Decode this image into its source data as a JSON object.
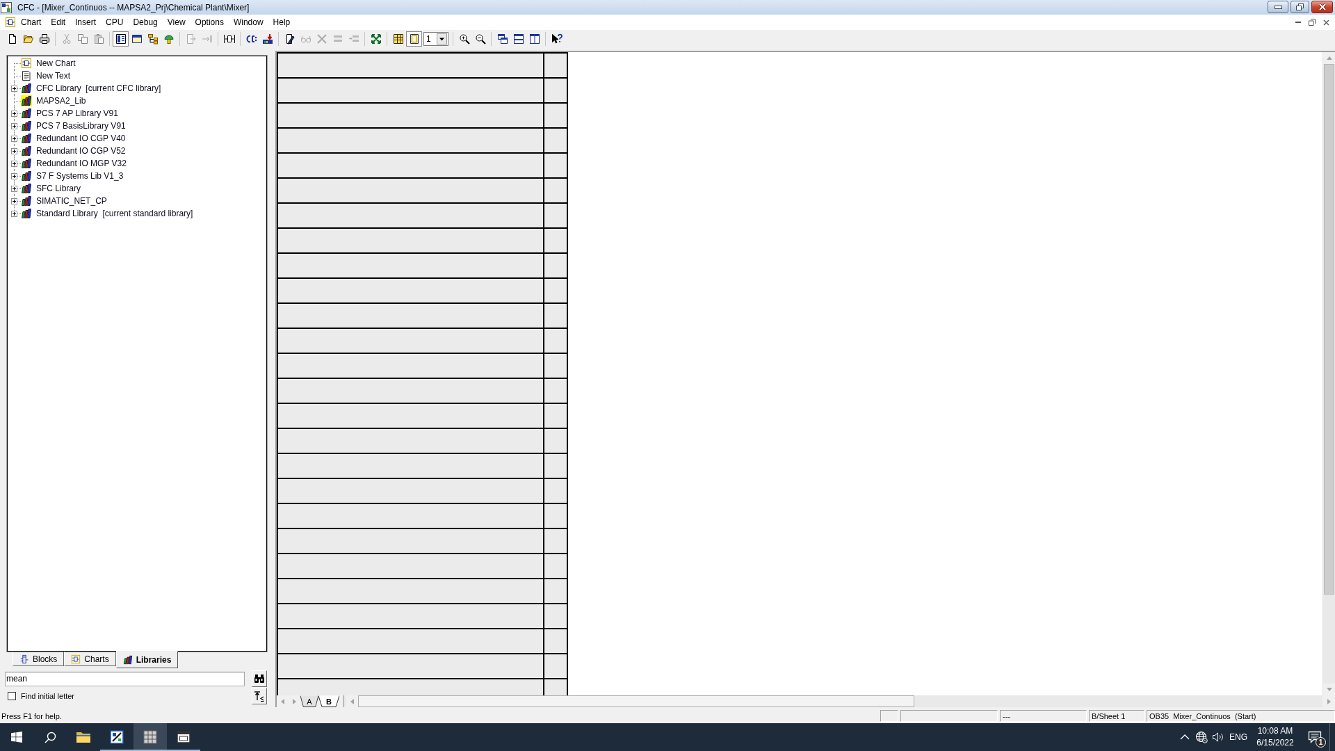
{
  "window": {
    "title": "CFC - [Mixer_Continuos -- MAPSA2_Prj\\Chemical Plant\\Mixer]"
  },
  "menu": [
    "Chart",
    "Edit",
    "Insert",
    "CPU",
    "Debug",
    "View",
    "Options",
    "Window",
    "Help"
  ],
  "toolbar": {
    "groups": [
      [
        {
          "kind": "new",
          "disabled": false,
          "pressed": false
        },
        {
          "kind": "open",
          "disabled": false,
          "pressed": false
        },
        {
          "kind": "print",
          "disabled": false,
          "pressed": false
        }
      ],
      [
        {
          "kind": "cut",
          "disabled": true,
          "pressed": false
        },
        {
          "kind": "copy",
          "disabled": true,
          "pressed": false
        },
        {
          "kind": "paste",
          "disabled": true,
          "pressed": false
        }
      ],
      [
        {
          "kind": "catalog",
          "disabled": false,
          "pressed": true
        },
        {
          "kind": "window",
          "disabled": false,
          "pressed": false
        },
        {
          "kind": "tree",
          "disabled": false,
          "pressed": false
        },
        {
          "kind": "lamp",
          "disabled": false,
          "pressed": false
        }
      ],
      [
        {
          "kind": "pagearrow",
          "disabled": true,
          "pressed": false
        },
        {
          "kind": "arrowbar",
          "disabled": true,
          "pressed": false
        }
      ],
      [
        {
          "kind": "block",
          "disabled": false,
          "pressed": false
        }
      ],
      [
        {
          "kind": "brackets",
          "disabled": false,
          "pressed": false
        },
        {
          "kind": "download",
          "disabled": false,
          "pressed": false
        }
      ],
      [
        {
          "kind": "pencil",
          "disabled": false,
          "pressed": false
        },
        {
          "kind": "glasses",
          "disabled": true,
          "pressed": false
        },
        {
          "kind": "tools",
          "disabled": true,
          "pressed": false
        },
        {
          "kind": "bars",
          "disabled": true,
          "pressed": false
        },
        {
          "kind": "barsarrow",
          "disabled": true,
          "pressed": false
        }
      ],
      [
        {
          "kind": "fit",
          "disabled": false,
          "pressed": false
        }
      ],
      [
        {
          "kind": "table",
          "disabled": false,
          "pressed": false
        },
        {
          "kind": "sheet",
          "disabled": false,
          "pressed": true
        },
        {
          "kind": "combo",
          "value": "1"
        }
      ],
      [
        {
          "kind": "zoomin",
          "disabled": false,
          "pressed": false
        },
        {
          "kind": "zoomout",
          "disabled": false,
          "pressed": false
        }
      ],
      [
        {
          "kind": "cascade",
          "disabled": false,
          "pressed": false
        },
        {
          "kind": "hsplit",
          "disabled": false,
          "pressed": false
        },
        {
          "kind": "vsplit",
          "disabled": false,
          "pressed": false
        }
      ],
      [
        {
          "kind": "help",
          "disabled": false,
          "pressed": false
        }
      ]
    ]
  },
  "catalog": {
    "tree": [
      {
        "label": "New Chart",
        "kind": "chart",
        "highlighted": false
      },
      {
        "label": "New Text",
        "kind": "text",
        "highlighted": false
      },
      {
        "label": "CFC Library  [current CFC library]",
        "kind": "library",
        "expanded": false,
        "highlighted": false
      },
      {
        "label": "MAPSA2_Lib",
        "kind": "library",
        "highlighted": true
      },
      {
        "label": "PCS 7 AP Library V91",
        "kind": "library",
        "expanded": false,
        "highlighted": false
      },
      {
        "label": "PCS 7 BasisLibrary V91",
        "kind": "library",
        "expanded": false,
        "highlighted": false
      },
      {
        "label": "Redundant IO CGP V40",
        "kind": "library",
        "expanded": false,
        "highlighted": false
      },
      {
        "label": "Redundant IO CGP V52",
        "kind": "library",
        "expanded": false,
        "highlighted": false
      },
      {
        "label": "Redundant IO MGP V32",
        "kind": "library",
        "expanded": false,
        "highlighted": false
      },
      {
        "label": "S7 F Systems Lib V1_3",
        "kind": "library",
        "expanded": false,
        "highlighted": false
      },
      {
        "label": "SFC Library",
        "kind": "library",
        "expanded": false,
        "highlighted": false
      },
      {
        "label": "SIMATIC_NET_CP",
        "kind": "library",
        "expanded": false,
        "highlighted": false
      },
      {
        "label": "Standard Library  [current standard library]",
        "kind": "library",
        "expanded": false,
        "highlighted": false
      }
    ],
    "tabs": [
      {
        "label": "Blocks",
        "kind": "blocks",
        "selected": false
      },
      {
        "label": "Charts",
        "kind": "charts",
        "selected": false
      },
      {
        "label": "Libraries",
        "kind": "libraries",
        "selected": true
      }
    ],
    "search": {
      "value": "mean"
    },
    "find_initial_letter": {
      "label": "Find initial letter",
      "checked": false
    }
  },
  "chart": {
    "sheet_tabs": [
      {
        "label": "A",
        "selected": false
      },
      {
        "label": "B",
        "selected": true
      }
    ]
  },
  "status_bar": {
    "message": "Press F1 for help.",
    "panels": [
      "---",
      "B/Sheet 1",
      "OB35  Mixer_Continuos  (Start)"
    ]
  },
  "taskbar": {
    "apps": [
      {
        "kind": "explorer",
        "running": false,
        "active": false
      },
      {
        "kind": "chartapp",
        "running": true,
        "active": false
      },
      {
        "kind": "gridapp",
        "running": true,
        "active": true
      },
      {
        "kind": "windowapp",
        "running": true,
        "active": false
      }
    ],
    "tray": {
      "language": "ENG",
      "time": "10:08 AM",
      "date": "6/15/2022",
      "notification_count": "1"
    }
  }
}
